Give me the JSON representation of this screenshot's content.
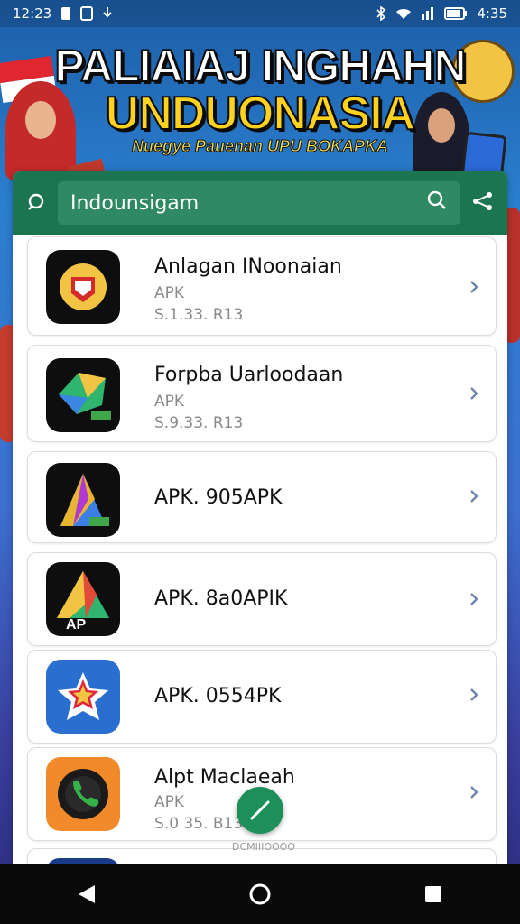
{
  "status_bar": {
    "time_left": "12:23",
    "time_right": "4:35",
    "icons": [
      "notification-icon",
      "sim-icon",
      "download-icon",
      "bluetooth-icon",
      "wifi-icon",
      "signal-icon",
      "battery-icon"
    ]
  },
  "banner": {
    "title_line1": "PALIAIAJ INGHAHN",
    "title_line2": "UNDUONASIA",
    "tagline": "Nuegye Pauenan UPU BOKAPKA"
  },
  "toolbar": {
    "search_value": "Indounsigam",
    "left_icon": "search-small-icon",
    "right_icon": "share-icon"
  },
  "apps": [
    {
      "title": "Anlagan INoonaian",
      "type": "APK",
      "version": "S.1.33. R13",
      "icon": "garuda-emblem-icon"
    },
    {
      "title": "Forpba Uarloodaan",
      "type": "APK",
      "version": "S.9.33. R13",
      "icon": "polygon-icon"
    },
    {
      "title": "APK. 905APK",
      "type": "",
      "version": "",
      "icon": "triangle-a-icon"
    },
    {
      "title": "APK. 8a0APIK",
      "type": "",
      "version": "",
      "icon": "ap-triangle-icon"
    },
    {
      "title": "APK. 0554PK",
      "type": "",
      "version": "",
      "icon": "star-badge-icon"
    },
    {
      "title": "Alpt Maclaeah",
      "type": "APK",
      "version": "S.0 35. B13",
      "icon": "phone-call-icon"
    }
  ],
  "fab": {
    "caption": "DCMIIIOOOO"
  },
  "colors": {
    "toolbar": "#1c7551",
    "accent": "#1d8f5a"
  }
}
